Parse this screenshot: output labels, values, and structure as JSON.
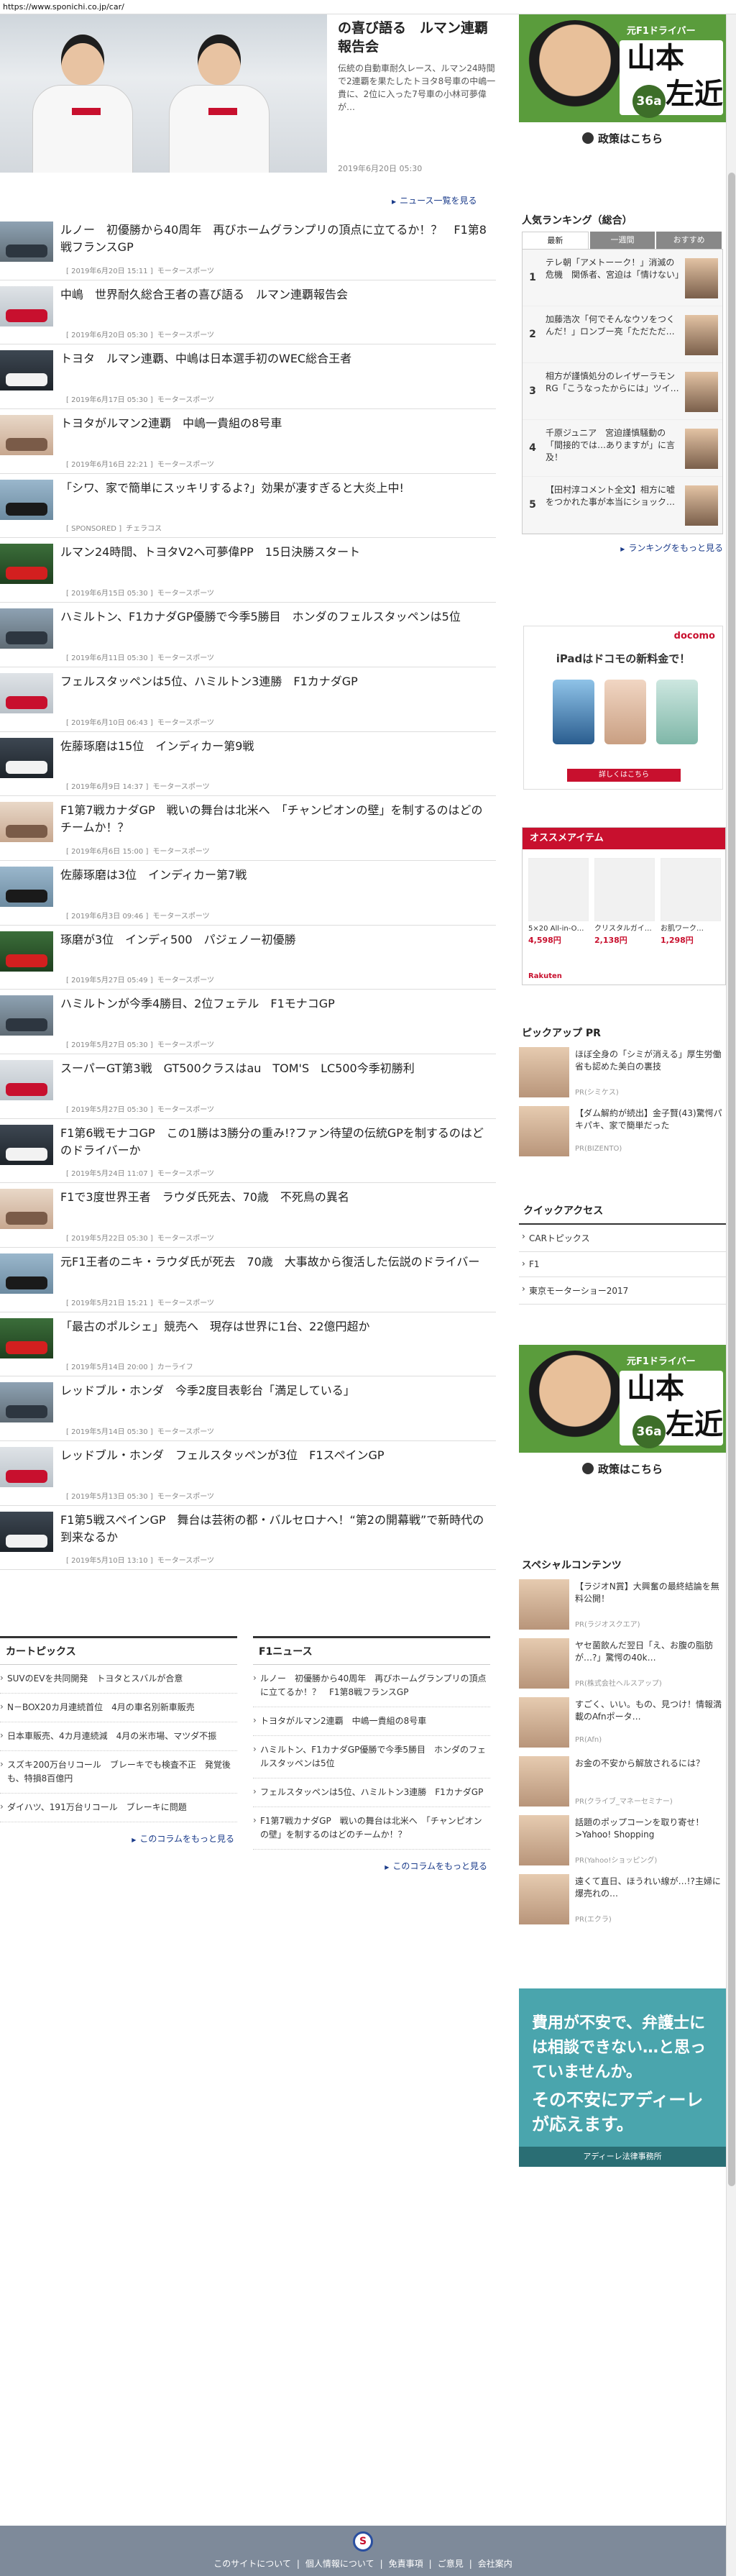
{
  "url": "https://www.sponichi.co.jp/car/",
  "hero": {
    "title": "の喜び語る　ルマン連覇報告会",
    "desc": "伝統の自動車耐久レース、ルマン24時間で2連覇を果たしたトヨタ8号車の中嶋一貴に、2位に入った7号車の小林可夢偉が…",
    "date": "2019年6月20日 05:30",
    "more": "ニュース一覧を見る"
  },
  "news": [
    {
      "title": "ルノー　初優勝から40周年　再びホームグランプリの頂点に立てるか！？　F1第8戦フランスGP",
      "date": "2019年6月20日 15:11",
      "cat": "モータースポーツ"
    },
    {
      "title": "中嶋　世界耐久総合王者の喜び語る　ルマン連覇報告会",
      "date": "2019年6月20日 05:30",
      "cat": "モータースポーツ"
    },
    {
      "title": "トヨタ　ルマン連覇、中嶋は日本選手初のWEC総合王者",
      "date": "2019年6月17日 05:30",
      "cat": "モータースポーツ"
    },
    {
      "title": "トヨタがルマン2連覇　中嶋一貴組の8号車",
      "date": "2019年6月16日 22:21",
      "cat": "モータースポーツ"
    },
    {
      "title": "「シワ、家で簡単にスッキリするよ?」効果が凄すぎると大炎上中!",
      "date": "SPONSORED",
      "cat": "チェラコス"
    },
    {
      "title": "ルマン24時間、トヨタV2へ可夢偉PP　15日決勝スタート",
      "date": "2019年6月15日 05:30",
      "cat": "モータースポーツ"
    },
    {
      "title": "ハミルトン、F1カナダGP優勝で今季5勝目　ホンダのフェルスタッペンは5位",
      "date": "2019年6月11日 05:30",
      "cat": "モータースポーツ"
    },
    {
      "title": "フェルスタッペンは5位、ハミルトン3連勝　F1カナダGP",
      "date": "2019年6月10日 06:43",
      "cat": "モータースポーツ"
    },
    {
      "title": "佐藤琢磨は15位　インディカー第9戦",
      "date": "2019年6月9日 14:37",
      "cat": "モータースポーツ"
    },
    {
      "title": "F1第7戦カナダGP　戦いの舞台は北米へ　「チャンピオンの壁」を制するのはどのチームか！？",
      "date": "2019年6月6日 15:00",
      "cat": "モータースポーツ"
    },
    {
      "title": "佐藤琢磨は3位　インディカー第7戦",
      "date": "2019年6月3日 09:46",
      "cat": "モータースポーツ"
    },
    {
      "title": "琢磨が3位　インディ500　パジェノー初優勝",
      "date": "2019年5月27日 05:49",
      "cat": "モータースポーツ"
    },
    {
      "title": "ハミルトンが今季4勝目、2位フェテル　F1モナコGP",
      "date": "2019年5月27日 05:30",
      "cat": "モータースポーツ"
    },
    {
      "title": "スーパーGT第3戦　GT500クラスはau　TOM'S　LC500今季初勝利",
      "date": "2019年5月27日 05:30",
      "cat": "モータースポーツ"
    },
    {
      "title": "F1第6戦モナコGP　この1勝は3勝分の重み!?ファン待望の伝統GPを制するのはどのドライバーか",
      "date": "2019年5月24日 11:07",
      "cat": "モータースポーツ"
    },
    {
      "title": "F1で3度世界王者　ラウダ氏死去、70歳　不死鳥の異名",
      "date": "2019年5月22日 05:30",
      "cat": "モータースポーツ"
    },
    {
      "title": "元F1王者のニキ・ラウダ氏が死去　70歳　大事故から復活した伝説のドライバー",
      "date": "2019年5月21日 15:21",
      "cat": "モータースポーツ"
    },
    {
      "title": "「最古のポルシェ」競売へ　現存は世界に1台、22億円超か",
      "date": "2019年5月14日 20:00",
      "cat": "カーライフ"
    },
    {
      "title": "レッドブル・ホンダ　今季2度目表彰台「満足している」",
      "date": "2019年5月14日 05:30",
      "cat": "モータースポーツ"
    },
    {
      "title": "レッドブル・ホンダ　フェルスタッペンが3位　F1スペインGP",
      "date": "2019年5月13日 05:30",
      "cat": "モータースポーツ"
    },
    {
      "title": "F1第5戦スペインGP　舞台は芸術の都・バルセロナへ！“第2の開幕戦”で新時代の到来なるか",
      "date": "2019年5月10日 13:10",
      "cat": "モータースポーツ"
    }
  ],
  "cartopics": {
    "title": "カートピックス",
    "items": [
      "SUVのEVを共同開発　トヨタとスバルが合意",
      "N－BOX20カ月連続首位　4月の車名別新車販売",
      "日本車販売、4カ月連続減　4月の米市場、マツダ不振",
      "スズキ200万台リコール　ブレーキでも検査不正　発覚後も、特損8百億円",
      "ダイハツ、191万台リコール　ブレーキに問題"
    ],
    "more": "このコラムをもっと見る"
  },
  "f1news": {
    "title": "F1ニュース",
    "items": [
      "ルノー　初優勝から40周年　再びホームグランプリの頂点に立てるか！？　F1第8戦フランスGP",
      "トヨタがルマン2連覇　中嶋一貴組の8号車",
      "ハミルトン、F1カナダGP優勝で今季5勝目　ホンダのフェルスタッペンは5位",
      "フェルスタッペンは5位、ハミルトン3連勝　F1カナダGP",
      "F1第7戦カナダGP　戦いの舞台は北米へ　「チャンピオンの壁」を制するのはどのチームか！？"
    ],
    "more": "このコラムをもっと見る"
  },
  "ad_driver": {
    "tag": "元F1ドライバー",
    "name_top": "山本",
    "name_bottom": "左近",
    "age": "36a",
    "cta": "政策はこちら"
  },
  "ranking": {
    "title": "人気ランキング（総合）",
    "tabs": [
      "最新",
      "一週間",
      "おすすめ"
    ],
    "items": [
      {
        "num": "1",
        "text": "テレ朝「アメトーーク！」消滅の危機　関係者、宮迫は「情けない」"
      },
      {
        "num": "2",
        "text": "加藤浩次「何でそんなウソをつくんだ！」ロンブー亮「ただただ…"
      },
      {
        "num": "3",
        "text": "相方が謹慎処分のレイザーラモンRG「こうなったからには」ツイ…"
      },
      {
        "num": "4",
        "text": "千原ジュニア　宮迫謹慎騒動の「間接的では…ありますが」に言及！"
      },
      {
        "num": "5",
        "text": "【田村淳コメント全文】相方に嘘をつかれた事が本当にショック…"
      }
    ],
    "more": "ランキングをもっと見る"
  },
  "docomo": {
    "logo": "docomo",
    "headline": "iPadはドコモの新料金で！",
    "button": "詳しくはこちら"
  },
  "osusume": {
    "title": "オススメアイテム",
    "products": [
      {
        "name": "5×20 All-in-O…",
        "price": "4,598円"
      },
      {
        "name": "クリスタルガイ…",
        "price": "2,138円"
      },
      {
        "name": "お肌ワーク…",
        "price": "1,298円"
      }
    ],
    "footer": "Rakuten"
  },
  "pickup_pr": {
    "title": "ピックアップ PR",
    "items": [
      {
        "text": "ほぼ全身の「シミが消える」厚生労働省も認めた美白の裏技",
        "src": "PR(シミケス)"
      },
      {
        "text": "【ダム解約が続出】金子賢(43)驚愕パキパキ、家で簡単だった",
        "src": "PR(BIZENTO)"
      }
    ]
  },
  "quick_access": {
    "title": "クイックアクセス",
    "items": [
      "CARトピックス",
      "F1",
      "東京モーターショー2017"
    ]
  },
  "special": {
    "title": "スペシャルコンテンツ",
    "items": [
      {
        "text": "【ラジオN賞】大興奮の最終結論を無料公開！",
        "src": "PR(ラジオスクエア)"
      },
      {
        "text": "ヤセ菌飲んだ翌日「え、お腹の脂肪が…?」驚愕の40k…",
        "src": "PR(株式会社ヘルスアップ)"
      },
      {
        "text": "すごく、いい。もの、見つけ！情報満載のAfnポータ…",
        "src": "PR(Afn)"
      },
      {
        "text": "お金の不安から解放されるには？",
        "src": "PR(クライブ_マネーセミナー)"
      },
      {
        "text": "話題のポップコーンを取り寄せ！>Yahoo! Shopping",
        "src": "PR(Yahoo!ショッピング)"
      },
      {
        "text": "遠くて直日、ほうれい線が…!?主婦に爆売れの…",
        "src": "PR(エクラ)"
      }
    ]
  },
  "lawyer": {
    "line1": "費用が不安で、弁護士には相談できない…と思っていませんか。",
    "line2": "その不安にアディーレが応えます。",
    "foot": "アディーレ法律事務所"
  },
  "footer": {
    "logo": "S",
    "links": [
      "このサイトについて",
      "個人情報について",
      "免責事項",
      "ご意見",
      "会社案内"
    ]
  }
}
